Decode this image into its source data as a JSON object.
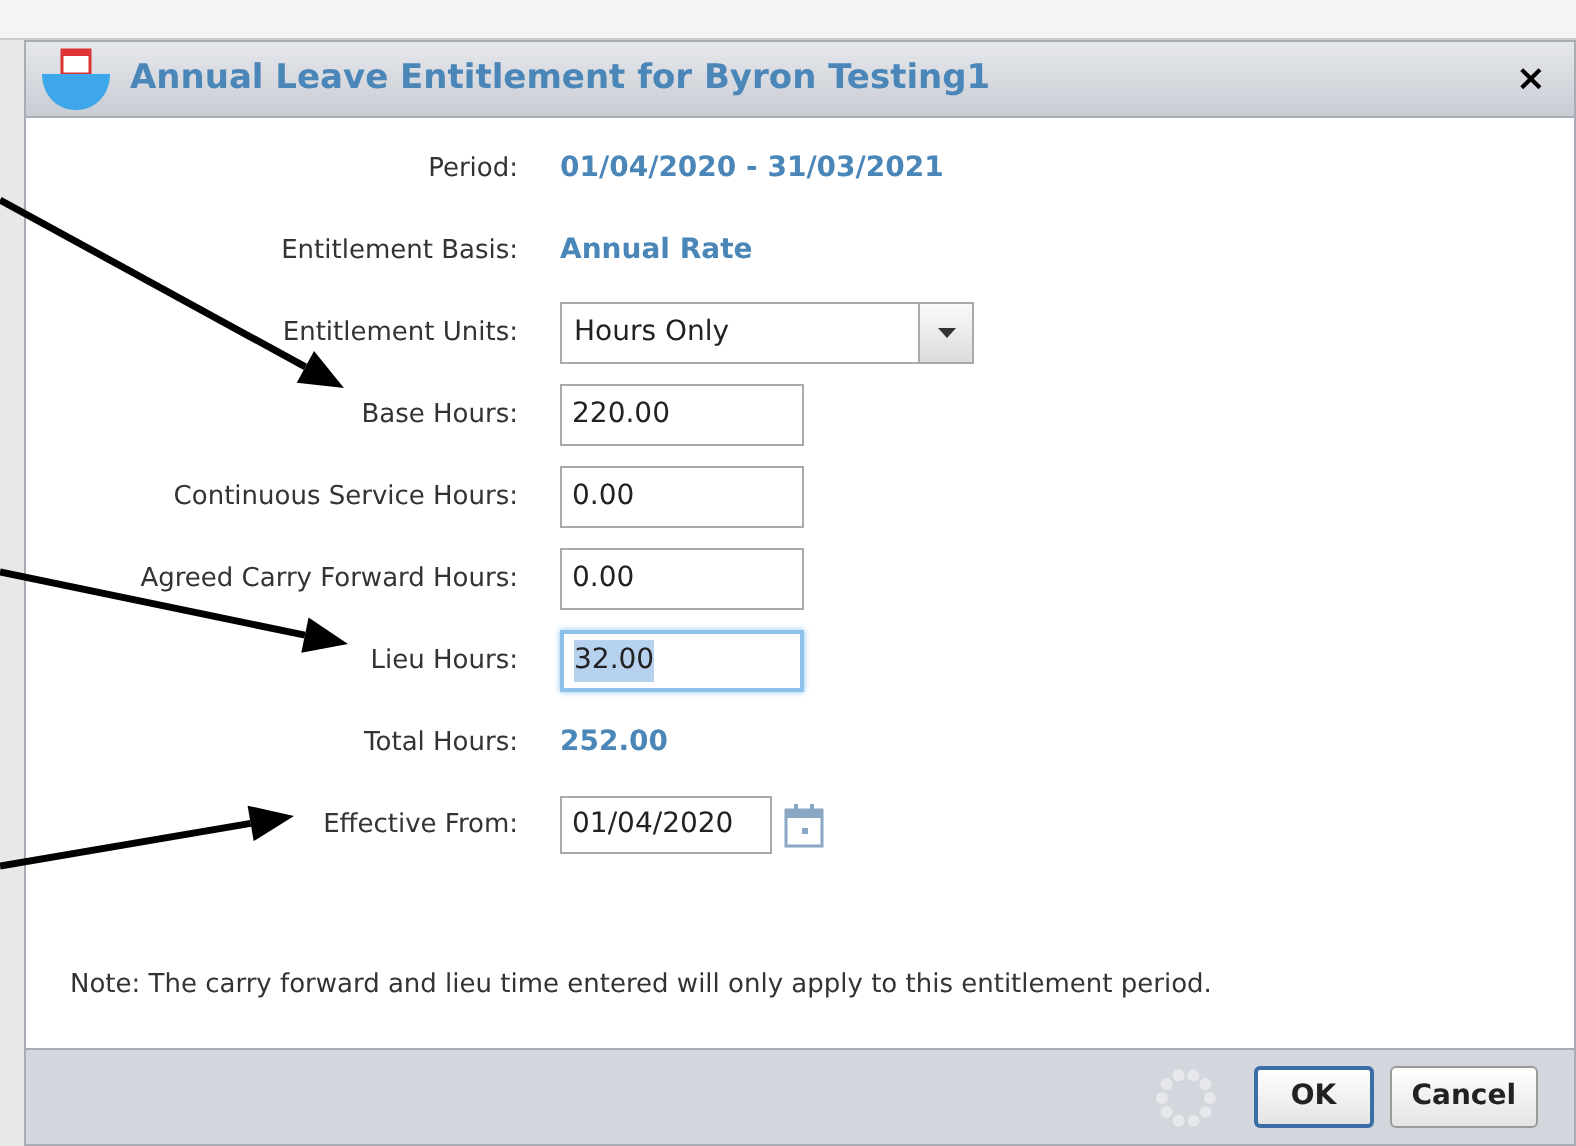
{
  "dialog": {
    "title": "Annual Leave Entitlement for Byron Testing1",
    "close": "×"
  },
  "rows": [
    {
      "kind": "text",
      "label": "Period:",
      "value": "01/04/2020 - 31/03/2021"
    },
    {
      "kind": "text",
      "label": "Entitlement Basis:",
      "value": "Annual Rate"
    },
    {
      "kind": "select",
      "label": "Entitlement Units:",
      "value": "Hours Only"
    },
    {
      "kind": "input",
      "label": "Base Hours:",
      "value": "220.00",
      "focused": false
    },
    {
      "kind": "input",
      "label": "Continuous Service Hours:",
      "value": "0.00",
      "focused": false
    },
    {
      "kind": "input",
      "label": "Agreed Carry Forward Hours:",
      "value": "0.00",
      "focused": false
    },
    {
      "kind": "input",
      "label": "Lieu Hours:",
      "value": "32.00",
      "focused": true
    },
    {
      "kind": "text",
      "label": "Total Hours:",
      "value": "252.00"
    },
    {
      "kind": "date",
      "label": "Effective From:",
      "value": "01/04/2020"
    }
  ],
  "note": "Note: The carry forward and lieu time entered will only apply to this entitlement period.",
  "buttons": [
    {
      "label": "OK",
      "default": true
    },
    {
      "label": "Cancel",
      "default": false
    }
  ]
}
